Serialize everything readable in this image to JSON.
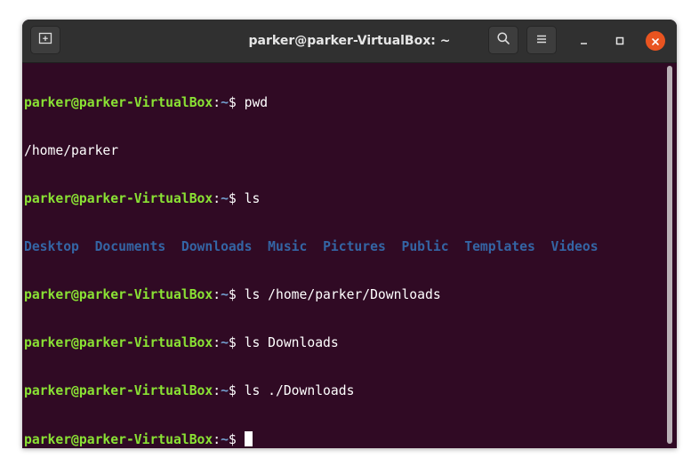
{
  "window": {
    "title": "parker@parker-VirtualBox: ~"
  },
  "titlebar": {
    "new_tab_icon": "new-tab-icon",
    "search_icon": "search-icon",
    "menu_icon": "hamburger-menu-icon",
    "minimize_icon": "minimize-icon",
    "maximize_icon": "maximize-icon",
    "close_icon": "close-icon"
  },
  "terminal": {
    "prompt_user": "parker@parker-VirtualBox",
    "prompt_colon": ":",
    "prompt_path": "~",
    "prompt_symbol": "$ ",
    "lines": [
      {
        "type": "command",
        "text": "pwd"
      },
      {
        "type": "output",
        "text": "/home/parker"
      },
      {
        "type": "command",
        "text": "ls"
      },
      {
        "type": "dirs",
        "items": [
          "Desktop",
          "Documents",
          "Downloads",
          "Music",
          "Pictures",
          "Public",
          "Templates",
          "Videos"
        ]
      },
      {
        "type": "command",
        "text": "ls /home/parker/Downloads"
      },
      {
        "type": "command",
        "text": "ls Downloads"
      },
      {
        "type": "command",
        "text": "ls ./Downloads"
      },
      {
        "type": "prompt",
        "text": ""
      }
    ]
  },
  "colors": {
    "background": "#300a24",
    "prompt_user": "#8ae234",
    "prompt_path": "#729fcf",
    "directory": "#3465a4",
    "text": "#ffffff",
    "close_button": "#e95420"
  }
}
